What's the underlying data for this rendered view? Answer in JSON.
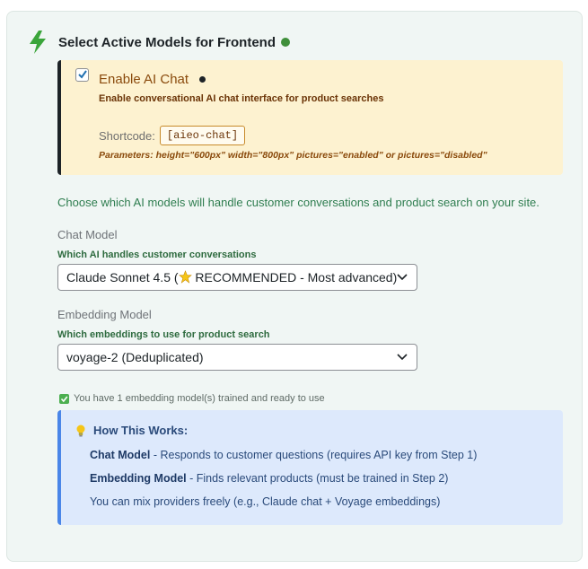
{
  "section": {
    "title": "Select Active Models for Frontend",
    "status_dot_color": "#3f8f3a",
    "icon": "lightning-bolt-icon"
  },
  "chat": {
    "enabled": true,
    "title": "Enable AI Chat",
    "description": "Enable conversational AI chat interface for product searches",
    "shortcode_label": "Shortcode:",
    "shortcode": "[aieo-chat]",
    "parameters": "Parameters: height=\"600px\" width=\"800px\" pictures=\"enabled\" or pictures=\"disabled\""
  },
  "intro": "Choose which AI models will handle customer conversations and product search on your site.",
  "chat_model": {
    "label": "Chat Model",
    "help": "Which AI handles customer conversations",
    "selected_prefix": "Claude Sonnet 4.5 (",
    "selected_suffix": " RECOMMENDED - Most advanced)"
  },
  "embedding_model": {
    "label": "Embedding Model",
    "help": "Which embeddings to use for product search",
    "selected": "voyage-2 (Deduplicated)",
    "status": "You have 1 embedding model(s) trained and ready to use"
  },
  "how_it_works": {
    "title": "How This Works:",
    "items": [
      {
        "term": "Chat Model",
        "text": " - Responds to customer questions (requires API key from Step 1)"
      },
      {
        "term": "Embedding Model",
        "text": " - Finds relevant products (must be trained in Step 2)"
      },
      {
        "term": "",
        "text": "You can mix providers freely (e.g., Claude chat + Voyage embeddings)"
      }
    ]
  },
  "colors": {
    "accent_green": "#2e7d4f",
    "chat_box_bg": "#fdf2d0",
    "info_box_bg": "#dde9fc",
    "info_border": "#4a86e8"
  }
}
